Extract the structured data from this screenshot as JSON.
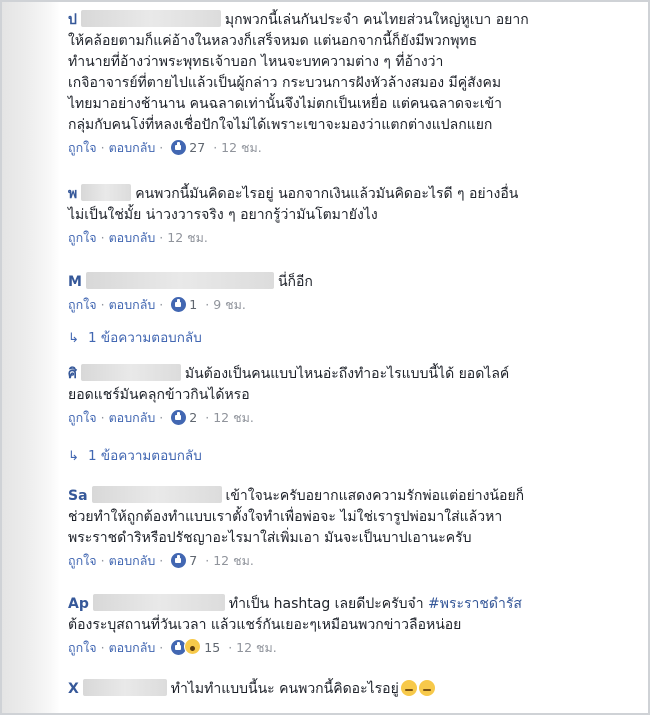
{
  "labels": {
    "like": "ถูกใจ",
    "reply": "ตอบกลับ",
    "sep": "·"
  },
  "comments": [
    {
      "name": "ป",
      "lines": [
        "มุกพวกนี้เล่นกันประจำ คนไทยส่วนใหญ่หูเบา อยาก",
        "ให้คล้อยตามก็แค่อ้างในหลวงก็เสร็จหมด แต่นอกจากนี้ก็ยังมีพวกพุทธ",
        "ทำนายที่อ้างว่าพระพุทธเจ้าบอก ไหนจะบทความต่าง ๆ ที่อ้างว่า",
        "เกจิอาจารย์ที่ตายไปแล้วเป็นผู้กล่าว กระบวนการฝังหัวล้างสมอง มีคู่สังคม",
        "ไทยมาอย่างช้านาน คนฉลาดเท่านั้นจึงไม่ตกเป็นเหยื่อ แต่คนฉลาดจะเข้า",
        "กลุ่มกับคนโง่ที่หลงเชื่อปักใจไม่ได้เพราะเขาจะมองว่าแตกต่างแปลกแยก"
      ],
      "likes": "27",
      "time": "12 ชม."
    },
    {
      "name": "พ",
      "lines": [
        "คนพวกนี้มันคิดอะไรอยู่ นอกจากเงินแล้วมันคิดอะไรดี ๆ อย่างอื่น",
        "ไม่เป็นใช่มั้ย น่าวงวารจริง ๆ อยากรู้ว่ามันโตมายังไง"
      ],
      "likes": "",
      "time": "12 ชม."
    },
    {
      "name": "M",
      "lines": [
        "นี่ก็อีก"
      ],
      "likes": "1",
      "time": "9 ชม.",
      "replies": "1 ข้อความตอบกลับ"
    },
    {
      "name": "ศิ",
      "lines": [
        "มันต้องเป็นคนแบบไหนอ่ะถึงทำอะไรแบบนี้ได้ ยอดไลค์",
        "ยอดแชร์มันคลุกข้าวกินได้หรอ"
      ],
      "likes": "2",
      "time": "12 ชม.",
      "replies": "1 ข้อความตอบกลับ"
    },
    {
      "name": "Sa",
      "lines": [
        "เข้าใจนะครับอยากแสดงความรักพ่อแต่อย่างน้อยก็",
        "ช่วยทำให้ถูกต้องทำแบบเราตั้งใจทำเพื่อพ่อจะ ไม่ใช่เรารูปพ่อมาใส่แล้วหา",
        "พระราชดำริหรือปรัชญาอะไรมาใส่เพิ่มเอา มันจะเป็นบาปเอานะครับ"
      ],
      "likes": "7",
      "time": "12 ชม."
    },
    {
      "name": "Ap",
      "lines_pre": "ทำเป็น hashtag เลยดีปะครับจ๋า",
      "hashtag": "#พระราชดำรัส",
      "line2": "ต้องระบุสถานที่วันเวลา แล้วแชร์กันเยอะๆเหมือนพวกข่าวลือหน่อย",
      "likes": "15",
      "time": "12 ชม."
    },
    {
      "name": "X",
      "lines": [
        "ทำไมทำแบบนี้นะ คนพวกนี้คิดอะไรอยู่"
      ]
    }
  ]
}
